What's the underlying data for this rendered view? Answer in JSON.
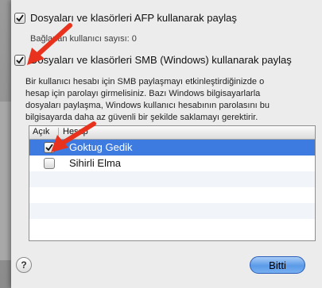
{
  "afp": {
    "label": "Dosyaları ve klasörleri AFP kullanarak paylaş",
    "checked": true,
    "count_text": "Bağlanan kullanıcı sayısı: 0"
  },
  "smb": {
    "label": "Dosyaları ve klasörleri SMB (Windows) kullanarak paylaş",
    "checked": true,
    "description": "Bir kullanıcı hesabı için SMB paylaşmayı etkinleştirdiğinizde o\nhesap için parolayı girmelisiniz. Bazı Windows bilgisayarlarla\ndosyaları paylaşma, Windows kullanıcı hesabının parolasını bu\nbilgisayarda daha az güvenli bir şekilde saklamayı gerektirir."
  },
  "accounts_table": {
    "headers": {
      "on": "Açık",
      "account": "Hesap"
    },
    "rows": [
      {
        "name": "Goktug Gedik",
        "on": true,
        "selected": true
      },
      {
        "name": "Sihirli Elma",
        "on": false,
        "selected": false
      }
    ]
  },
  "footer": {
    "help_label": "?",
    "done_label": "Bitti"
  },
  "colors": {
    "selection": "#3d7be0",
    "annotation_arrow": "#e8321e"
  },
  "icons": [
    "checkbox-checked-icon",
    "checkbox-unchecked-icon",
    "help-icon",
    "annotation-arrow-icon"
  ]
}
